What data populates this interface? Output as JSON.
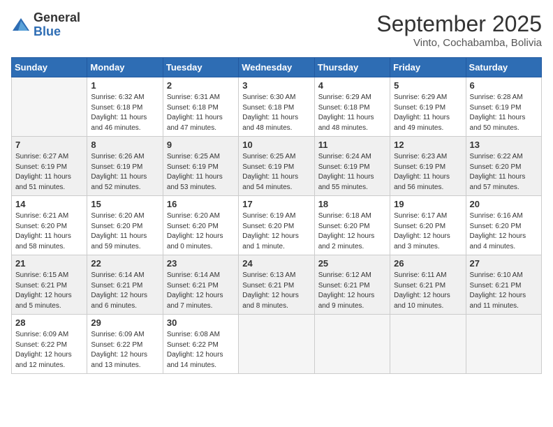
{
  "logo": {
    "general": "General",
    "blue": "Blue"
  },
  "title": "September 2025",
  "location": "Vinto, Cochabamba, Bolivia",
  "days_of_week": [
    "Sunday",
    "Monday",
    "Tuesday",
    "Wednesday",
    "Thursday",
    "Friday",
    "Saturday"
  ],
  "weeks": [
    [
      {
        "num": "",
        "info": ""
      },
      {
        "num": "1",
        "info": "Sunrise: 6:32 AM\nSunset: 6:18 PM\nDaylight: 11 hours\nand 46 minutes."
      },
      {
        "num": "2",
        "info": "Sunrise: 6:31 AM\nSunset: 6:18 PM\nDaylight: 11 hours\nand 47 minutes."
      },
      {
        "num": "3",
        "info": "Sunrise: 6:30 AM\nSunset: 6:18 PM\nDaylight: 11 hours\nand 48 minutes."
      },
      {
        "num": "4",
        "info": "Sunrise: 6:29 AM\nSunset: 6:18 PM\nDaylight: 11 hours\nand 48 minutes."
      },
      {
        "num": "5",
        "info": "Sunrise: 6:29 AM\nSunset: 6:19 PM\nDaylight: 11 hours\nand 49 minutes."
      },
      {
        "num": "6",
        "info": "Sunrise: 6:28 AM\nSunset: 6:19 PM\nDaylight: 11 hours\nand 50 minutes."
      }
    ],
    [
      {
        "num": "7",
        "info": "Sunrise: 6:27 AM\nSunset: 6:19 PM\nDaylight: 11 hours\nand 51 minutes."
      },
      {
        "num": "8",
        "info": "Sunrise: 6:26 AM\nSunset: 6:19 PM\nDaylight: 11 hours\nand 52 minutes."
      },
      {
        "num": "9",
        "info": "Sunrise: 6:25 AM\nSunset: 6:19 PM\nDaylight: 11 hours\nand 53 minutes."
      },
      {
        "num": "10",
        "info": "Sunrise: 6:25 AM\nSunset: 6:19 PM\nDaylight: 11 hours\nand 54 minutes."
      },
      {
        "num": "11",
        "info": "Sunrise: 6:24 AM\nSunset: 6:19 PM\nDaylight: 11 hours\nand 55 minutes."
      },
      {
        "num": "12",
        "info": "Sunrise: 6:23 AM\nSunset: 6:19 PM\nDaylight: 11 hours\nand 56 minutes."
      },
      {
        "num": "13",
        "info": "Sunrise: 6:22 AM\nSunset: 6:20 PM\nDaylight: 11 hours\nand 57 minutes."
      }
    ],
    [
      {
        "num": "14",
        "info": "Sunrise: 6:21 AM\nSunset: 6:20 PM\nDaylight: 11 hours\nand 58 minutes."
      },
      {
        "num": "15",
        "info": "Sunrise: 6:20 AM\nSunset: 6:20 PM\nDaylight: 11 hours\nand 59 minutes."
      },
      {
        "num": "16",
        "info": "Sunrise: 6:20 AM\nSunset: 6:20 PM\nDaylight: 12 hours\nand 0 minutes."
      },
      {
        "num": "17",
        "info": "Sunrise: 6:19 AM\nSunset: 6:20 PM\nDaylight: 12 hours\nand 1 minute."
      },
      {
        "num": "18",
        "info": "Sunrise: 6:18 AM\nSunset: 6:20 PM\nDaylight: 12 hours\nand 2 minutes."
      },
      {
        "num": "19",
        "info": "Sunrise: 6:17 AM\nSunset: 6:20 PM\nDaylight: 12 hours\nand 3 minutes."
      },
      {
        "num": "20",
        "info": "Sunrise: 6:16 AM\nSunset: 6:20 PM\nDaylight: 12 hours\nand 4 minutes."
      }
    ],
    [
      {
        "num": "21",
        "info": "Sunrise: 6:15 AM\nSunset: 6:21 PM\nDaylight: 12 hours\nand 5 minutes."
      },
      {
        "num": "22",
        "info": "Sunrise: 6:14 AM\nSunset: 6:21 PM\nDaylight: 12 hours\nand 6 minutes."
      },
      {
        "num": "23",
        "info": "Sunrise: 6:14 AM\nSunset: 6:21 PM\nDaylight: 12 hours\nand 7 minutes."
      },
      {
        "num": "24",
        "info": "Sunrise: 6:13 AM\nSunset: 6:21 PM\nDaylight: 12 hours\nand 8 minutes."
      },
      {
        "num": "25",
        "info": "Sunrise: 6:12 AM\nSunset: 6:21 PM\nDaylight: 12 hours\nand 9 minutes."
      },
      {
        "num": "26",
        "info": "Sunrise: 6:11 AM\nSunset: 6:21 PM\nDaylight: 12 hours\nand 10 minutes."
      },
      {
        "num": "27",
        "info": "Sunrise: 6:10 AM\nSunset: 6:21 PM\nDaylight: 12 hours\nand 11 minutes."
      }
    ],
    [
      {
        "num": "28",
        "info": "Sunrise: 6:09 AM\nSunset: 6:22 PM\nDaylight: 12 hours\nand 12 minutes."
      },
      {
        "num": "29",
        "info": "Sunrise: 6:09 AM\nSunset: 6:22 PM\nDaylight: 12 hours\nand 13 minutes."
      },
      {
        "num": "30",
        "info": "Sunrise: 6:08 AM\nSunset: 6:22 PM\nDaylight: 12 hours\nand 14 minutes."
      },
      {
        "num": "",
        "info": ""
      },
      {
        "num": "",
        "info": ""
      },
      {
        "num": "",
        "info": ""
      },
      {
        "num": "",
        "info": ""
      }
    ]
  ]
}
